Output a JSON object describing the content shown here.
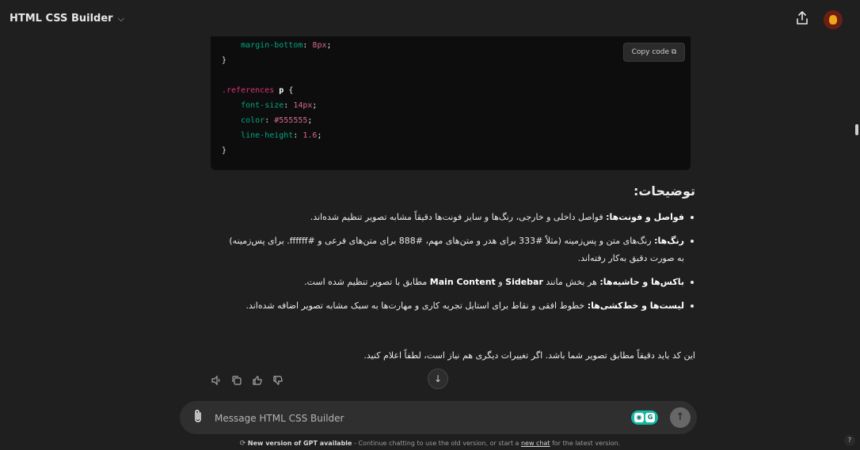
{
  "header": {
    "app_title": "HTML CSS Builder",
    "chevron_icon": "chevron-down-icon",
    "share_icon": "share-upload-icon",
    "avatar_icon": "user-avatar"
  },
  "code_block": {
    "copy_label": "Copy code",
    "lines": [
      {
        "prop": "margin-bottom",
        "value": "8px"
      },
      {
        "brace": "}"
      },
      {
        "selector_class": ".references",
        "selector_tag": "p",
        "open": "{"
      },
      {
        "prop": "font-size",
        "value": "14px"
      },
      {
        "prop": "color",
        "value": "#555555"
      },
      {
        "prop": "line-height",
        "value": "1.6"
      },
      {
        "brace": "}"
      }
    ]
  },
  "answer": {
    "heading": "توضیحات:",
    "bullets": [
      {
        "bold": "فواصل و فونت‌ها:",
        "text": " فواصل داخلی و خارجی، رنگ‌ها و سایز فونت‌ها دقیقاً مشابه تصویر تنظیم شده‌اند."
      },
      {
        "bold": "رنگ‌ها:",
        "text": " رنگ‌های متن و پس‌زمینه (مثلاً #333 برای هدر و متن‌های مهم، #888 برای متن‌های فرعی و #ffffff. برای پس‌زمینه) به صورت دقیق به‌کار رفته‌اند."
      },
      {
        "bold": "باکس‌ها و حاشیه‌ها:",
        "text": " هر بخش مانند ",
        "bold2": "Sidebar",
        "text2": " و ",
        "bold3": "Main Content",
        "text3": " مطابق با تصویر تنظیم شده است."
      },
      {
        "bold": "لیست‌ها و خط‌کشی‌ها:",
        "text": " خطوط افقی و نقاط برای استایل تجربه کاری و مهارت‌ها به سبک مشابه تصویر اضافه شده‌اند."
      }
    ],
    "closing": "این کد باید دقیقاً مطابق تصویر شما باشد. اگر تغییرات دیگری هم نیاز است، لطفاً اعلام کنید."
  },
  "actions": {
    "read_aloud_icon": "speaker-icon",
    "copy_icon": "copy-icon",
    "thumbs_up_icon": "thumbs-up-icon",
    "thumbs_down_icon": "thumbs-down-icon",
    "scroll_down_icon": "arrow-down-icon"
  },
  "composer": {
    "placeholder": "Message HTML CSS Builder",
    "attach_icon": "paperclip-icon",
    "send_icon": "arrow-up-icon"
  },
  "footer": {
    "strong": "New version of GPT available",
    "text_before": " - Continue chatting to use the old version, or start a ",
    "link": "new chat",
    "text_after": " for the latest version."
  },
  "help": {
    "label": "?"
  }
}
